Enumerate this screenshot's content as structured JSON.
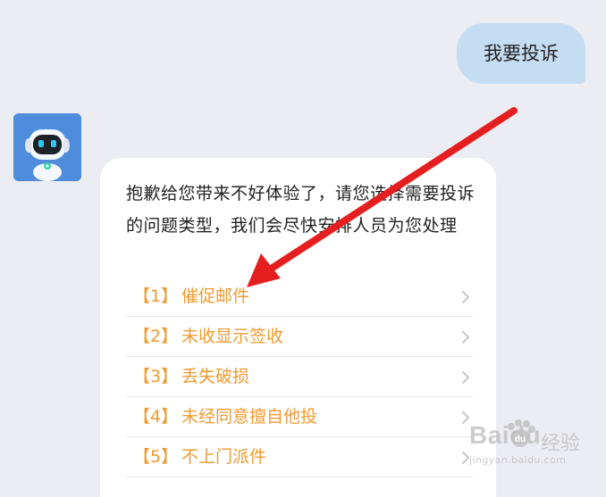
{
  "chat": {
    "user_message": "我要投诉",
    "bot_message": "抱歉给您带来不好体验了，请您选择需要投诉的问题类型，我们会尽快安排人员为您处理",
    "avatar_icon": "robot-icon",
    "options": [
      {
        "num": "【1】",
        "label": "催促邮件"
      },
      {
        "num": "【2】",
        "label": "未收显示签收"
      },
      {
        "num": "【3】",
        "label": "丢失破损"
      },
      {
        "num": "【4】",
        "label": "未经同意擅自他投"
      },
      {
        "num": "【5】",
        "label": "不上门派件"
      }
    ]
  },
  "colors": {
    "background": "#ececf3",
    "user_bubble": "#c5ddf2",
    "bot_bubble": "#ffffff",
    "option_text": "#ef9a2f",
    "annotation_arrow": "#e51f1f"
  },
  "watermark": {
    "name": "Baidu",
    "subtitle": "经验",
    "url": "jingyan.baidu.com"
  }
}
